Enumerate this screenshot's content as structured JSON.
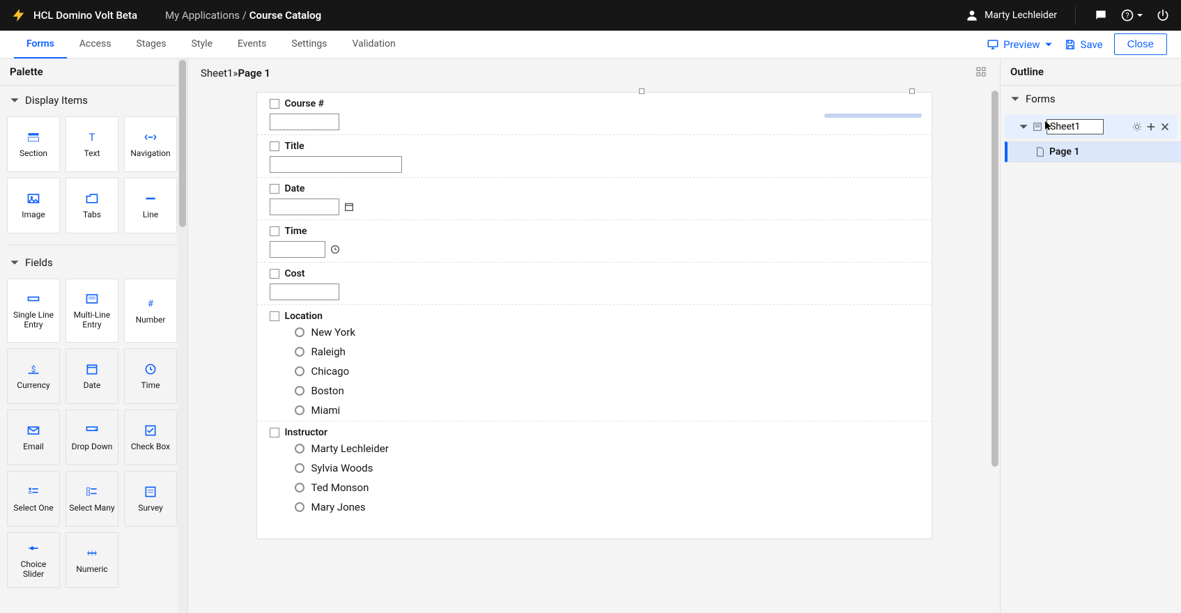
{
  "topbar": {
    "product": "HCL Domino Volt Beta",
    "breadcrumb_left": "My Applications",
    "breadcrumb_sep": " / ",
    "breadcrumb_right": "Course Catalog",
    "user": "Marty Lechleider"
  },
  "tabs": [
    "Forms",
    "Access",
    "Stages",
    "Style",
    "Events",
    "Settings",
    "Validation"
  ],
  "tabs_active_index": 0,
  "actions": {
    "preview": "Preview",
    "save": "Save",
    "close": "Close"
  },
  "palette": {
    "title": "Palette",
    "groups": {
      "display": {
        "header": "Display Items",
        "items": [
          "Section",
          "Text",
          "Navigation",
          "Image",
          "Tabs",
          "Line"
        ]
      },
      "fields": {
        "header": "Fields",
        "items": [
          "Single Line Entry",
          "Multi-Line Entry",
          "Number",
          "Currency",
          "Date",
          "Time",
          "Email",
          "Drop Down",
          "Check Box",
          "Select One",
          "Select Many",
          "Survey",
          "Choice Slider",
          "Numeric"
        ]
      }
    }
  },
  "canvas": {
    "breadcrumb_sheet": "Sheet1",
    "breadcrumb_sep": " » ",
    "breadcrumb_page": "Page 1",
    "fields": {
      "course": "Course #",
      "title": "Title",
      "date": "Date",
      "time": "Time",
      "cost": "Cost",
      "location": "Location",
      "location_options": [
        "New York",
        "Raleigh",
        "Chicago",
        "Boston",
        "Miami"
      ],
      "instructor": "Instructor",
      "instructor_options": [
        "Marty Lechleider",
        "Sylvia Woods",
        "Ted Monson",
        "Mary Jones"
      ]
    }
  },
  "outline": {
    "title": "Outline",
    "section": "Forms",
    "sheet_input": "Sheet1",
    "page": "Page 1"
  }
}
